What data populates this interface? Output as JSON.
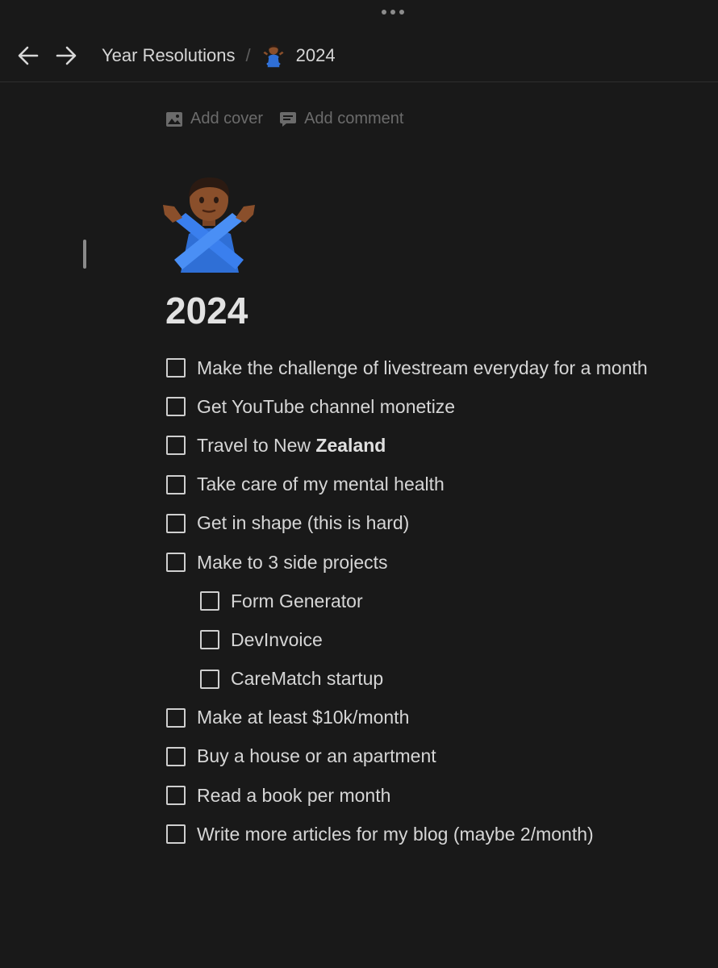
{
  "topbar": {
    "back_icon": "arrow-left-icon",
    "forward_icon": "arrow-right-icon",
    "more_icon": "more-horizontal-icon"
  },
  "breadcrumb": {
    "parent": "Year Resolutions",
    "separator": "/",
    "current_icon": "person-gesturing-no-emoji",
    "current": "2024"
  },
  "page_actions": {
    "add_cover": "Add cover",
    "add_cover_icon": "image-icon",
    "add_comment": "Add comment",
    "add_comment_icon": "comment-icon"
  },
  "page": {
    "icon": "person-gesturing-no-emoji",
    "title": "2024"
  },
  "todos": [
    {
      "text": "Make the challenge of livestream everyday for a month",
      "checked": false,
      "indent": 0
    },
    {
      "text": "Get YouTube channel monetize",
      "checked": false,
      "indent": 0
    },
    {
      "text_before": "Travel to New ",
      "text_bold": "Zealand",
      "checked": false,
      "indent": 0
    },
    {
      "text": "Take care of my mental health",
      "checked": false,
      "indent": 0
    },
    {
      "text": "Get in shape (this is hard)",
      "checked": false,
      "indent": 0
    },
    {
      "text": "Make to 3 side projects",
      "checked": false,
      "indent": 0
    },
    {
      "text": "Form Generator",
      "checked": false,
      "indent": 1
    },
    {
      "text": "DevInvoice",
      "checked": false,
      "indent": 1
    },
    {
      "text": "CareMatch startup",
      "checked": false,
      "indent": 1
    },
    {
      "text": "Make at least $10k/month",
      "checked": false,
      "indent": 0
    },
    {
      "text": "Buy a house or an apartment",
      "checked": false,
      "indent": 0
    },
    {
      "text": "Read a book per month",
      "checked": false,
      "indent": 0
    },
    {
      "text": "Write more articles for my blog (maybe 2/month)",
      "checked": false,
      "indent": 0
    }
  ],
  "colors": {
    "background": "#191919",
    "text": "#d6d6d6",
    "muted": "#6b6b6b"
  }
}
